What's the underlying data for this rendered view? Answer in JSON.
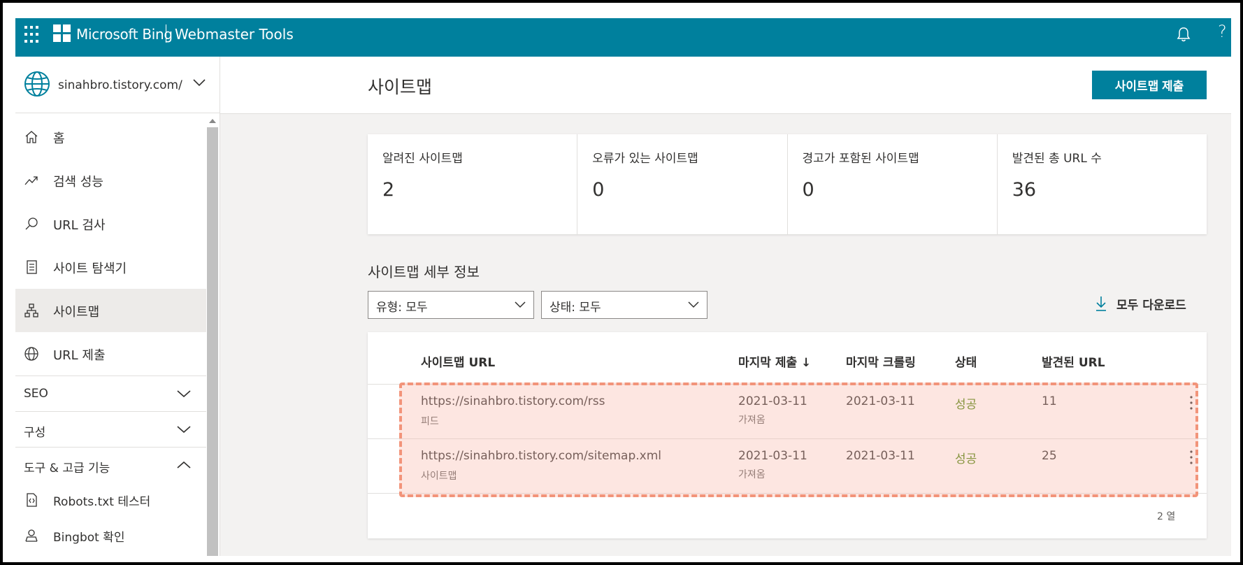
{
  "topbar": {
    "brand": "Microsoft Bing",
    "product": "Webmaster Tools",
    "help": "?"
  },
  "site": {
    "name": "sinahbro.tistory.com/"
  },
  "nav": {
    "items": [
      {
        "label": "홈",
        "icon": "home-icon"
      },
      {
        "label": "검색 성능",
        "icon": "trend-icon"
      },
      {
        "label": "URL 검사",
        "icon": "search-icon"
      },
      {
        "label": "사이트 탐색기",
        "icon": "document-icon"
      },
      {
        "label": "사이트맵",
        "icon": "sitemap-icon",
        "active": true
      },
      {
        "label": "URL 제출",
        "icon": "globe-icon"
      }
    ],
    "groups": [
      {
        "label": "SEO",
        "expanded": false
      },
      {
        "label": "구성",
        "expanded": false
      },
      {
        "label": "도구 & 고급 기능",
        "expanded": true
      }
    ],
    "subitems": [
      {
        "label": "Robots.txt 테스터",
        "icon": "code-file-icon"
      },
      {
        "label": "Bingbot 확인",
        "icon": "bot-icon"
      }
    ]
  },
  "header": {
    "title": "사이트맵",
    "submit_label": "사이트맵 제출"
  },
  "stats": [
    {
      "label": "알려진 사이트맵",
      "value": "2"
    },
    {
      "label": "오류가 있는 사이트맵",
      "value": "0"
    },
    {
      "label": "경고가 포함된 사이트맵",
      "value": "0"
    },
    {
      "label": "발견된 총 URL 수",
      "value": "36"
    }
  ],
  "details": {
    "title": "사이트맵 세부 정보",
    "filter_type": "유형: 모두",
    "filter_status": "상태: 모두",
    "download_label": "모두 다운로드"
  },
  "table": {
    "columns": [
      "사이트맵 URL",
      "마지막 제출 ↓",
      "마지막 크롤링",
      "상태",
      "발견된 URL"
    ],
    "rows": [
      {
        "url": "https://sinahbro.tistory.com/rss",
        "type": "피드",
        "submitted": "2021-03-11",
        "submitted_sub": "가져옴",
        "crawled": "2021-03-11",
        "status": "성공",
        "urls": "11"
      },
      {
        "url": "https://sinahbro.tistory.com/sitemap.xml",
        "type": "사이트맵",
        "submitted": "2021-03-11",
        "submitted_sub": "가져옴",
        "crawled": "2021-03-11",
        "status": "성공",
        "urls": "25"
      }
    ],
    "row_count": "2 열"
  },
  "colors": {
    "accent": "#00809d",
    "success": "#498205",
    "highlight": "#f2947a"
  }
}
